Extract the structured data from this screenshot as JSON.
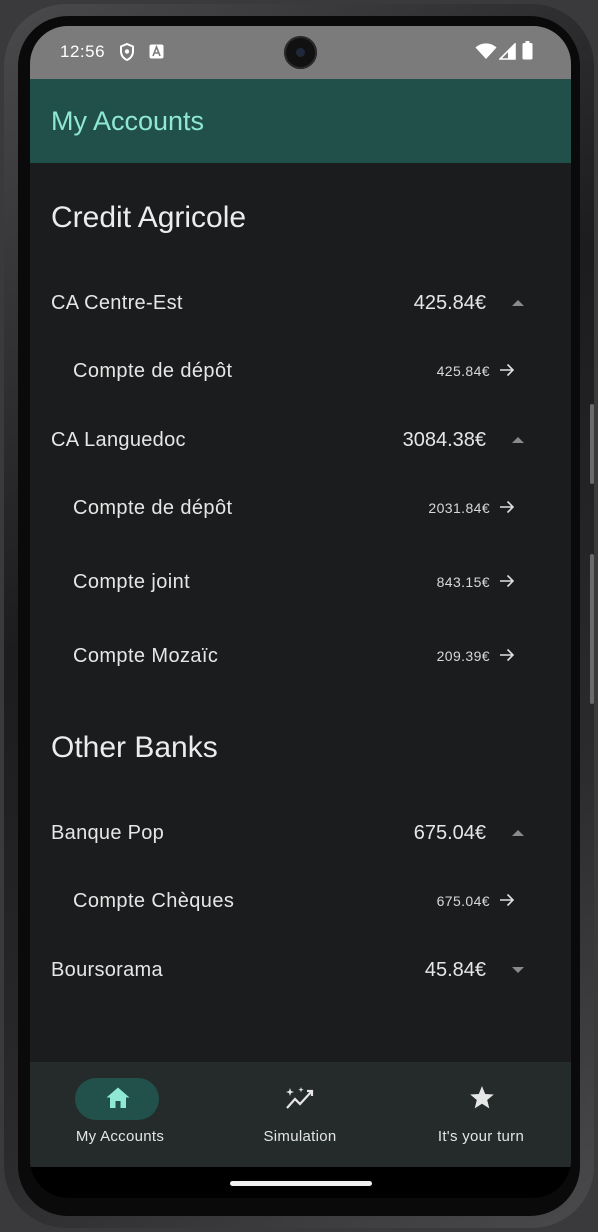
{
  "status_bar": {
    "time": "12:56",
    "icons": [
      "shield-icon",
      "keyboard-a-icon",
      "wifi-icon",
      "signal-icon",
      "battery-icon"
    ]
  },
  "app_bar": {
    "title": "My Accounts"
  },
  "sections": [
    {
      "title": "Credit Agricole",
      "banks": [
        {
          "name": "CA Centre-Est",
          "total": "425.84€",
          "expanded": true,
          "accounts": [
            {
              "name": "Compte de dépôt",
              "amount": "425.84€"
            }
          ]
        },
        {
          "name": "CA Languedoc",
          "total": "3084.38€",
          "expanded": true,
          "accounts": [
            {
              "name": "Compte de dépôt",
              "amount": "2031.84€"
            },
            {
              "name": "Compte joint",
              "amount": "843.15€"
            },
            {
              "name": "Compte Mozaïc",
              "amount": "209.39€"
            }
          ]
        }
      ]
    },
    {
      "title": "Other Banks",
      "banks": [
        {
          "name": "Banque Pop",
          "total": "675.04€",
          "expanded": true,
          "accounts": [
            {
              "name": "Compte Chèques",
              "amount": "675.04€"
            }
          ]
        },
        {
          "name": "Boursorama",
          "total": "45.84€",
          "expanded": false,
          "accounts": []
        }
      ]
    }
  ],
  "bottom_nav": {
    "items": [
      {
        "label": "My Accounts",
        "icon": "home-icon",
        "selected": true
      },
      {
        "label": "Simulation",
        "icon": "sparkle-chart-icon",
        "selected": false
      },
      {
        "label": "It's your turn",
        "icon": "star-icon",
        "selected": false
      }
    ]
  },
  "colors": {
    "app_bar_bg": "#21504a",
    "app_bar_title": "#8fe8d3",
    "background": "#1b1c1d",
    "bottom_nav_bg": "#242b2a",
    "nav_selected_pill": "#22504a",
    "nav_selected_icon": "#8fe8d3"
  }
}
